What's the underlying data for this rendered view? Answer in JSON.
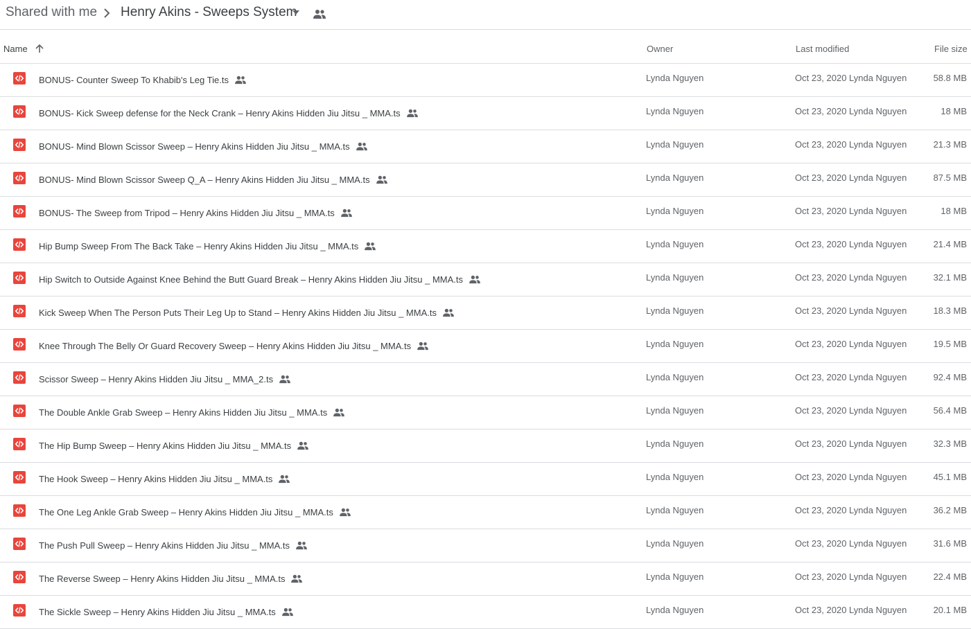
{
  "breadcrumb": {
    "parent": "Shared with me",
    "current": "Henry Akins - Sweeps System"
  },
  "columns": {
    "name": "Name",
    "owner": "Owner",
    "last_modified": "Last modified",
    "file_size": "File size"
  },
  "icons": {
    "file_type": "code-file-icon",
    "shared": "people-icon",
    "sort": "arrow-up-icon",
    "separator": "chevron-right-icon",
    "caret": "caret-down-icon"
  },
  "colors": {
    "file_icon": "#e8453c"
  },
  "files": [
    {
      "name": "BONUS- Counter Sweep To Khabib's Leg Tie.ts",
      "owner": "Lynda Nguyen",
      "modified": "Oct 23, 2020",
      "modifier": "Lynda Nguyen",
      "size": "58.8 MB"
    },
    {
      "name": "BONUS- Kick Sweep defense for the Neck Crank – Henry Akins Hidden Jiu Jitsu _ MMA.ts",
      "owner": "Lynda Nguyen",
      "modified": "Oct 23, 2020",
      "modifier": "Lynda Nguyen",
      "size": "18 MB"
    },
    {
      "name": "BONUS- Mind Blown Scissor Sweep – Henry Akins Hidden Jiu Jitsu _ MMA.ts",
      "owner": "Lynda Nguyen",
      "modified": "Oct 23, 2020",
      "modifier": "Lynda Nguyen",
      "size": "21.3 MB"
    },
    {
      "name": "BONUS- Mind Blown Scissor Sweep Q_A – Henry Akins Hidden Jiu Jitsu _ MMA.ts",
      "owner": "Lynda Nguyen",
      "modified": "Oct 23, 2020",
      "modifier": "Lynda Nguyen",
      "size": "87.5 MB"
    },
    {
      "name": "BONUS- The Sweep from Tripod – Henry Akins Hidden Jiu Jitsu _ MMA.ts",
      "owner": "Lynda Nguyen",
      "modified": "Oct 23, 2020",
      "modifier": "Lynda Nguyen",
      "size": "18 MB"
    },
    {
      "name": "Hip Bump Sweep From The Back Take – Henry Akins Hidden Jiu Jitsu _ MMA.ts",
      "owner": "Lynda Nguyen",
      "modified": "Oct 23, 2020",
      "modifier": "Lynda Nguyen",
      "size": "21.4 MB"
    },
    {
      "name": "Hip Switch to Outside Against Knee Behind the Butt Guard Break – Henry Akins Hidden Jiu Jitsu _ MMA.ts",
      "owner": "Lynda Nguyen",
      "modified": "Oct 23, 2020",
      "modifier": "Lynda Nguyen",
      "size": "32.1 MB"
    },
    {
      "name": "Kick Sweep When The Person Puts Their Leg Up to Stand – Henry Akins Hidden Jiu Jitsu _ MMA.ts",
      "owner": "Lynda Nguyen",
      "modified": "Oct 23, 2020",
      "modifier": "Lynda Nguyen",
      "size": "18.3 MB"
    },
    {
      "name": "Knee Through The Belly Or Guard Recovery Sweep – Henry Akins Hidden Jiu Jitsu _ MMA.ts",
      "owner": "Lynda Nguyen",
      "modified": "Oct 23, 2020",
      "modifier": "Lynda Nguyen",
      "size": "19.5 MB"
    },
    {
      "name": "Scissor Sweep – Henry Akins Hidden Jiu Jitsu _ MMA_2.ts",
      "owner": "Lynda Nguyen",
      "modified": "Oct 23, 2020",
      "modifier": "Lynda Nguyen",
      "size": "92.4 MB"
    },
    {
      "name": "The Double Ankle Grab Sweep – Henry Akins Hidden Jiu Jitsu _ MMA.ts",
      "owner": "Lynda Nguyen",
      "modified": "Oct 23, 2020",
      "modifier": "Lynda Nguyen",
      "size": "56.4 MB"
    },
    {
      "name": "The Hip Bump Sweep – Henry Akins Hidden Jiu Jitsu _ MMA.ts",
      "owner": "Lynda Nguyen",
      "modified": "Oct 23, 2020",
      "modifier": "Lynda Nguyen",
      "size": "32.3 MB"
    },
    {
      "name": "The Hook Sweep – Henry Akins Hidden Jiu Jitsu _ MMA.ts",
      "owner": "Lynda Nguyen",
      "modified": "Oct 23, 2020",
      "modifier": "Lynda Nguyen",
      "size": "45.1 MB"
    },
    {
      "name": "The One Leg Ankle Grab Sweep – Henry Akins Hidden Jiu Jitsu _ MMA.ts",
      "owner": "Lynda Nguyen",
      "modified": "Oct 23, 2020",
      "modifier": "Lynda Nguyen",
      "size": "36.2 MB"
    },
    {
      "name": "The Push Pull Sweep – Henry Akins Hidden Jiu Jitsu _ MMA.ts",
      "owner": "Lynda Nguyen",
      "modified": "Oct 23, 2020",
      "modifier": "Lynda Nguyen",
      "size": "31.6 MB"
    },
    {
      "name": "The Reverse Sweep – Henry Akins Hidden Jiu Jitsu _ MMA.ts",
      "owner": "Lynda Nguyen",
      "modified": "Oct 23, 2020",
      "modifier": "Lynda Nguyen",
      "size": "22.4 MB"
    },
    {
      "name": "The Sickle Sweep – Henry Akins Hidden Jiu Jitsu _ MMA.ts",
      "owner": "Lynda Nguyen",
      "modified": "Oct 23, 2020",
      "modifier": "Lynda Nguyen",
      "size": "20.1 MB"
    }
  ]
}
